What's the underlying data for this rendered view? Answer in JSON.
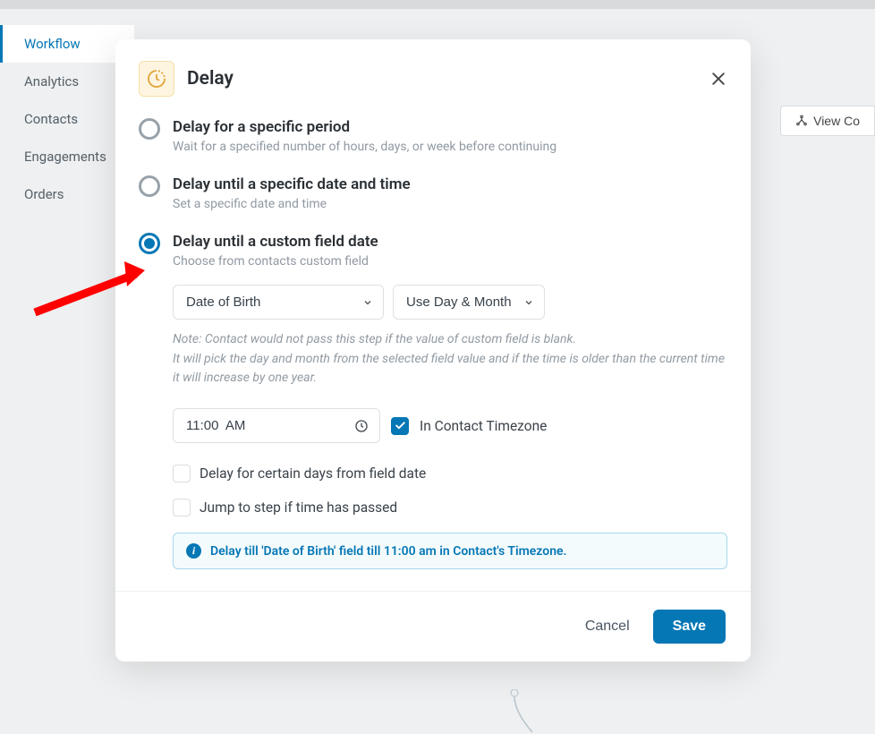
{
  "sidebar": {
    "items": [
      {
        "label": "Workflow",
        "active": true
      },
      {
        "label": "Analytics",
        "active": false
      },
      {
        "label": "Contacts",
        "active": false
      },
      {
        "label": "Engagements",
        "active": false
      },
      {
        "label": "Orders",
        "active": false
      }
    ]
  },
  "view_button": "View Co",
  "modal": {
    "title": "Delay",
    "options": [
      {
        "title": "Delay for a specific period",
        "desc": "Wait for a specified number of hours, days, or week before continuing",
        "selected": false
      },
      {
        "title": "Delay until a specific date and time",
        "desc": "Set a specific date and time",
        "selected": false
      },
      {
        "title": "Delay until a custom field date",
        "desc": "Choose from contacts custom field",
        "selected": true
      }
    ],
    "field_select": "Date of Birth",
    "mode_select": "Use Day & Month",
    "note_line1": "Note: Contact would not pass this step if the value of custom field is blank.",
    "note_line2": "It will pick the day and month from the selected field value and if the time is older than the current time it will increase by one year.",
    "time_value": "11:00  AM",
    "timezone_label": "In Contact Timezone",
    "delay_days_label": "Delay for certain days from field date",
    "jump_label": "Jump to step if time has passed",
    "info_text": "Delay till 'Date of Birth' field till 11:00 am in Contact's Timezone.",
    "cancel": "Cancel",
    "save": "Save"
  }
}
